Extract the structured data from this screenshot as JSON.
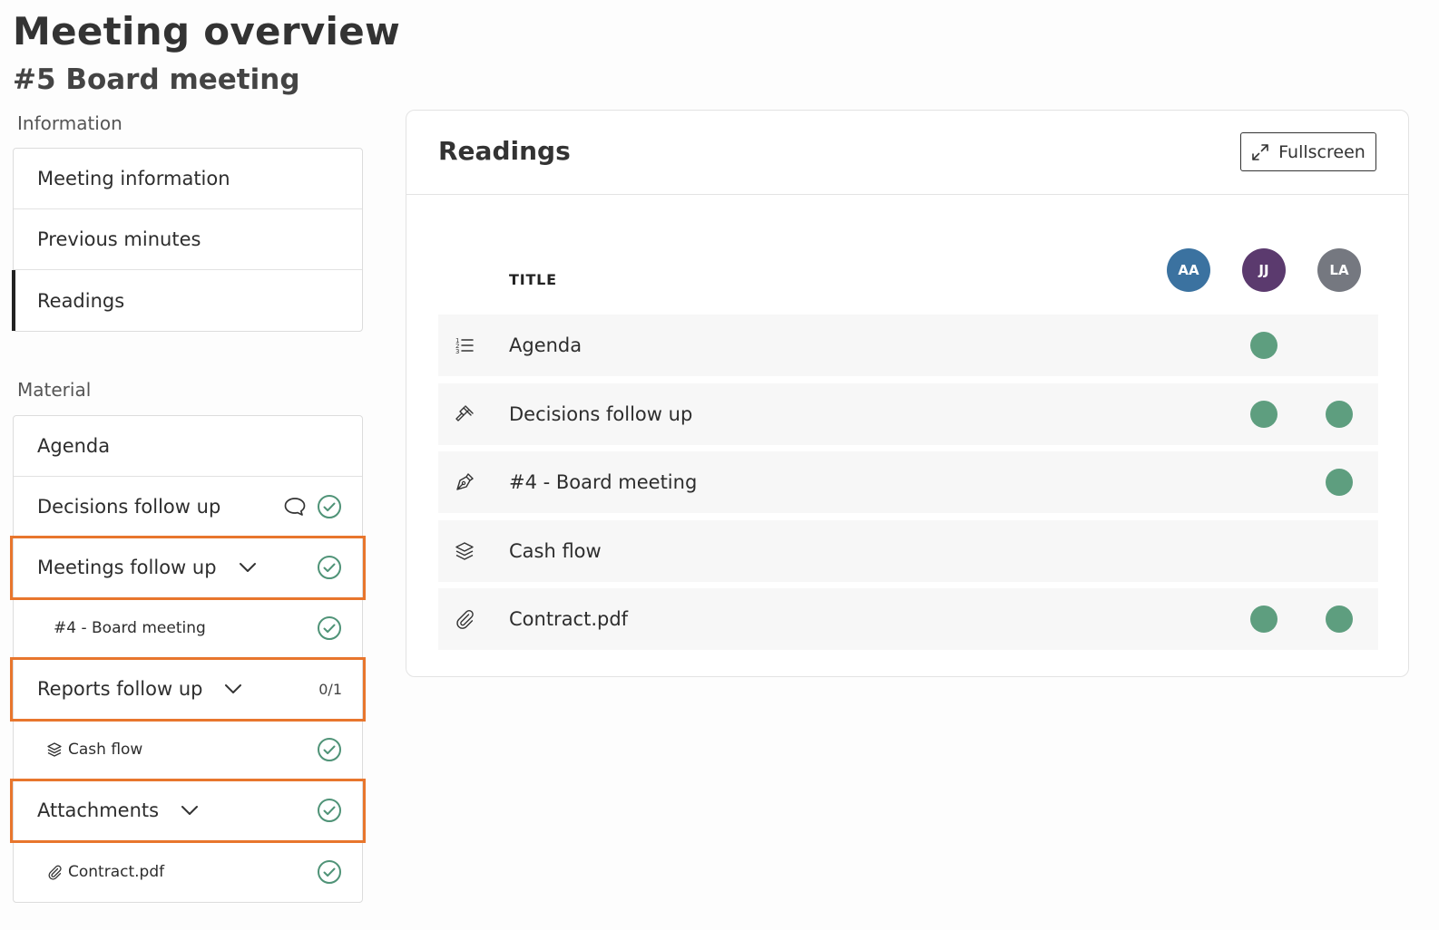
{
  "page": {
    "title": "Meeting overview",
    "subtitle": "#5 Board meeting"
  },
  "sidebar": {
    "information_label": "Information",
    "information_items": [
      {
        "label": "Meeting information"
      },
      {
        "label": "Previous minutes"
      },
      {
        "label": "Readings",
        "active": true
      }
    ],
    "material_label": "Material",
    "material_items": {
      "agenda": "Agenda",
      "decisions": "Decisions follow up",
      "meetings": "Meetings follow up",
      "meetings_sub": "#4 - Board meeting",
      "reports": "Reports follow up",
      "reports_count": "0/1",
      "reports_sub": "Cash flow",
      "attachments": "Attachments",
      "attachments_sub": "Contract.pdf"
    }
  },
  "readings": {
    "title": "Readings",
    "fullscreen_label": "Fullscreen",
    "column_title": "TITLE",
    "avatars": [
      {
        "initials": "AA",
        "color": "#3b72a0"
      },
      {
        "initials": "JJ",
        "color": "#5b3a6e"
      },
      {
        "initials": "LA",
        "color": "#757880"
      }
    ],
    "rows": [
      {
        "label": "Agenda",
        "icon": "numbered-list-icon",
        "read": [
          false,
          true,
          false
        ]
      },
      {
        "label": "Decisions follow up",
        "icon": "gavel-icon",
        "read": [
          false,
          true,
          true
        ]
      },
      {
        "label": "#4 - Board meeting",
        "icon": "pen-nib-icon",
        "read": [
          false,
          false,
          true
        ]
      },
      {
        "label": "Cash flow",
        "icon": "layers-icon",
        "read": [
          false,
          false,
          false
        ]
      },
      {
        "label": "Contract.pdf",
        "icon": "paperclip-icon",
        "read": [
          false,
          true,
          true
        ]
      }
    ],
    "read_color": "#5e9e7f"
  },
  "colors": {
    "highlight": "#e8762d",
    "check": "#4f9377"
  }
}
